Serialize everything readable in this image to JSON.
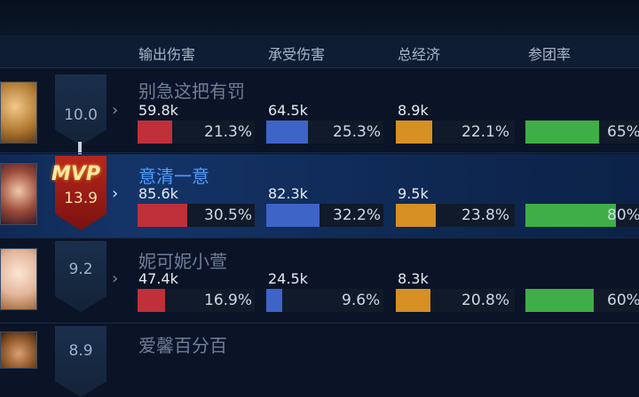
{
  "header": {
    "col_damage_dealt": "输出伤害",
    "col_damage_taken": "承受伤害",
    "col_economy": "总经济",
    "col_participation": "参团率"
  },
  "colors": {
    "damage_dealt": "#c0303a",
    "damage_taken": "#3e64c8",
    "economy": "#d69023",
    "participation": "#3fae46"
  },
  "players": [
    {
      "name": "别急这把有罚",
      "score": "10.0",
      "badge": "sword-icon",
      "damage_dealt": {
        "value": "59.8k",
        "pct": "21.3%",
        "fraction": 0.213
      },
      "damage_taken": {
        "value": "64.5k",
        "pct": "25.3%",
        "fraction": 0.253
      },
      "economy": {
        "value": "8.9k",
        "pct": "22.1%",
        "fraction": 0.221
      },
      "participation": {
        "pct": "65%",
        "fraction": 0.65
      }
    },
    {
      "name": "意清一意",
      "score": "13.9",
      "badge": "mvp",
      "mvp_label": "MVP",
      "damage_dealt": {
        "value": "85.6k",
        "pct": "30.5%",
        "fraction": 0.305
      },
      "damage_taken": {
        "value": "82.3k",
        "pct": "32.2%",
        "fraction": 0.322
      },
      "economy": {
        "value": "9.5k",
        "pct": "23.8%",
        "fraction": 0.238
      },
      "participation": {
        "pct": "80%",
        "fraction": 0.8
      }
    },
    {
      "name": "妮可妮小萱",
      "score": "9.2",
      "damage_dealt": {
        "value": "47.4k",
        "pct": "16.9%",
        "fraction": 0.169
      },
      "damage_taken": {
        "value": "24.5k",
        "pct": "9.6%",
        "fraction": 0.096
      },
      "economy": {
        "value": "8.3k",
        "pct": "20.8%",
        "fraction": 0.208
      },
      "participation": {
        "pct": "60%",
        "fraction": 0.6
      }
    },
    {
      "name": "爱馨百分百",
      "score": "8.9"
    }
  ]
}
